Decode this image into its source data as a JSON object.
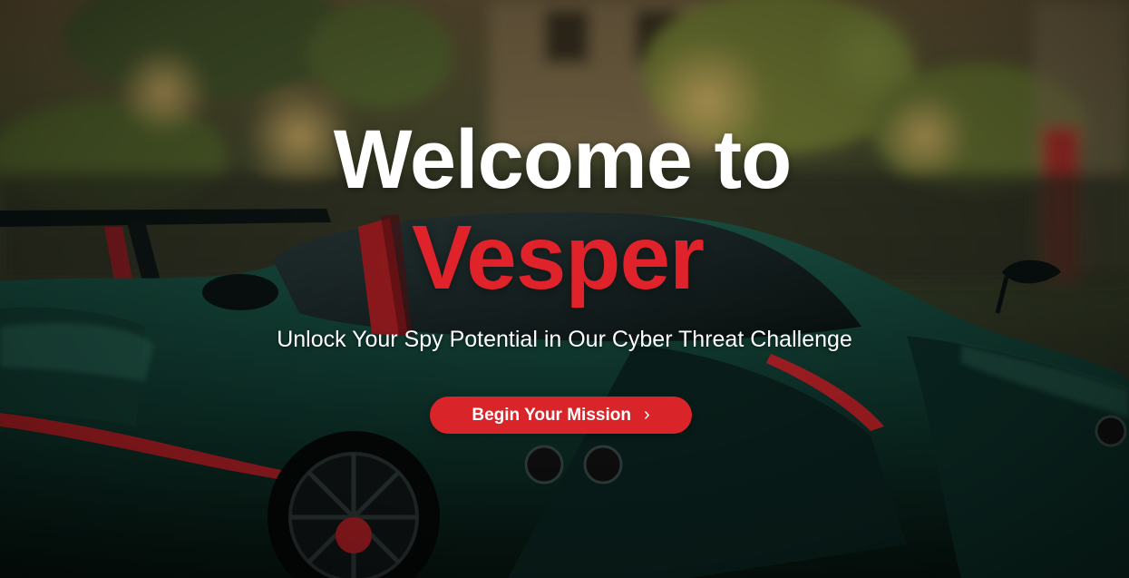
{
  "hero": {
    "title_line1": "Welcome to",
    "title_line2": "Vesper",
    "subtitle": "Unlock Your Spy Potential in Our Cyber Threat Challenge",
    "cta_label": "Begin Your Mission",
    "cta_icon": "chevron-right-icon"
  },
  "background": {
    "description_icon": "supercar-photo",
    "colors": {
      "accent": "#e0232a",
      "button": "#d9252a",
      "car_body": "#0d3a30"
    }
  }
}
